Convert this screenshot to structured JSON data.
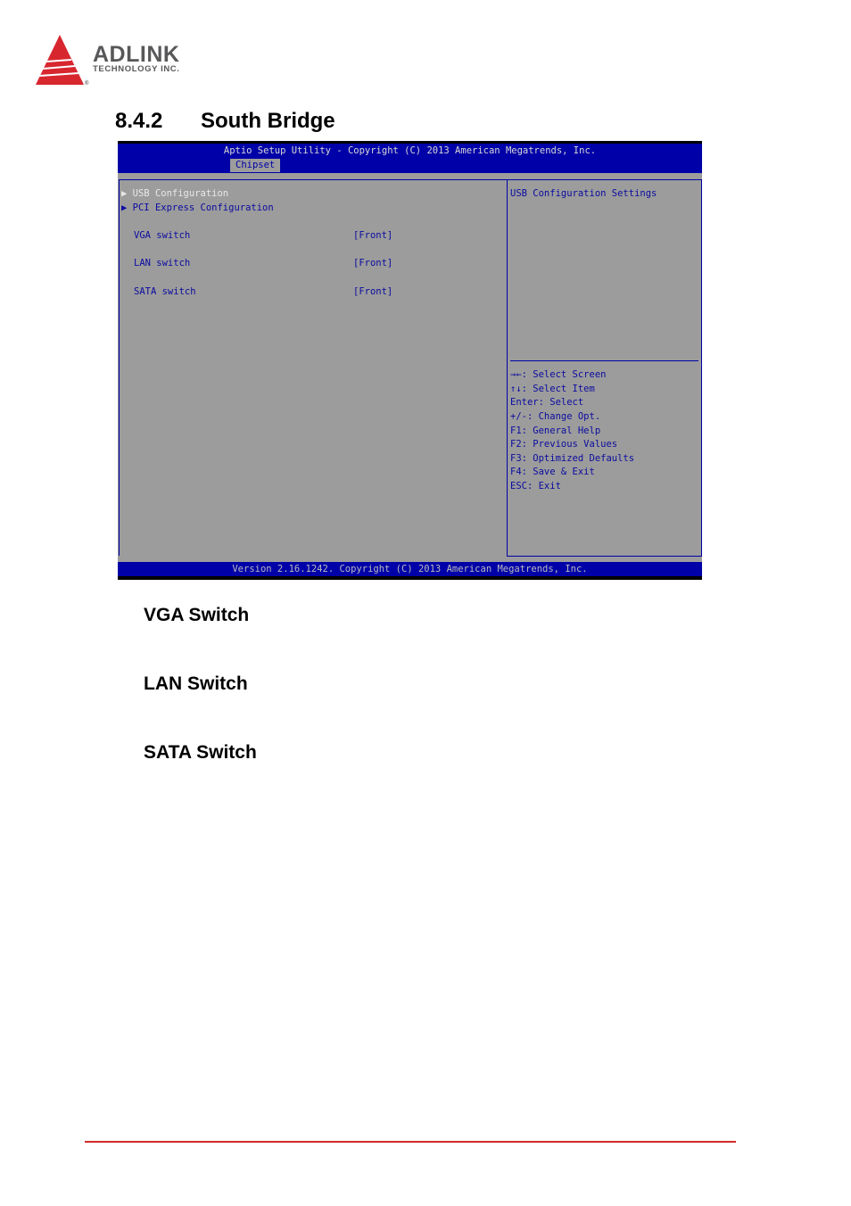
{
  "logo": {
    "name": "ADLINK",
    "tagline": "TECHNOLOGY INC."
  },
  "section": {
    "number": "8.4.2",
    "title": "South Bridge"
  },
  "bios": {
    "title": "Aptio Setup Utility - Copyright (C) 2013 American Megatrends, Inc.",
    "active_tab": "Chipset",
    "menu": [
      {
        "label": "USB Configuration",
        "submenu": true,
        "selected": true
      },
      {
        "label": "PCI Express Configuration",
        "submenu": true
      }
    ],
    "settings": [
      {
        "label": "VGA switch",
        "value": "[Front]"
      },
      {
        "label": "LAN switch",
        "value": "[Front]"
      },
      {
        "label": "SATA switch",
        "value": "[Front]"
      }
    ],
    "help_text": "USB Configuration Settings",
    "keys": [
      "→←: Select Screen",
      "↑↓: Select Item",
      "Enter: Select",
      "+/-: Change Opt.",
      "F1: General Help",
      "F2: Previous Values",
      "F3: Optimized Defaults",
      "F4: Save & Exit",
      "ESC: Exit"
    ],
    "footer": "Version 2.16.1242. Copyright (C) 2013 American Megatrends, Inc.",
    "colors": {
      "blue": "#0000a8",
      "gray": "#9c9c9c",
      "highlight": "#e8e8e8"
    }
  },
  "subsections": [
    "VGA Switch",
    "LAN Switch",
    "SATA Switch"
  ]
}
